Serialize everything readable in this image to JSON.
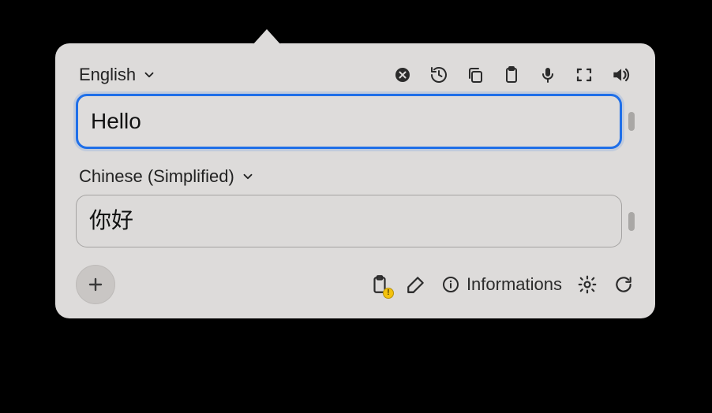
{
  "source": {
    "language_label": "English",
    "text": "Hello"
  },
  "target": {
    "language_label": "Chinese (Simplified)",
    "text": "你好"
  },
  "footer": {
    "info_label": "Informations"
  }
}
